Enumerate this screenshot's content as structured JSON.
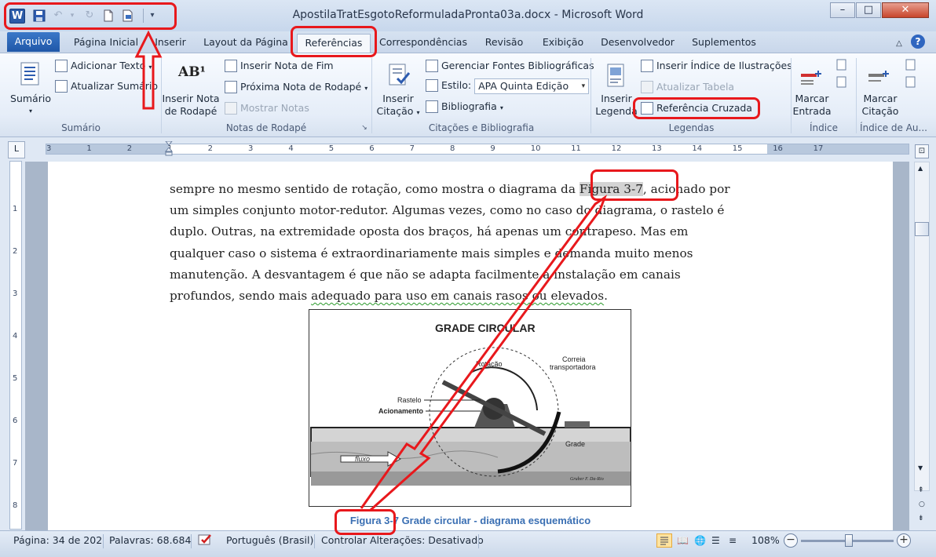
{
  "window": {
    "title": "ApostilaTratEsgotoReformuladaPronta03a.docx - Microsoft Word",
    "app_icon": "W",
    "minimize_label": "–",
    "maximize_label": "□",
    "close_label": "✕"
  },
  "tabs": {
    "file": "Arquivo",
    "items": [
      "Página Inicial",
      "Inserir",
      "Layout da Página",
      "Referências",
      "Correspondências",
      "Revisão",
      "Exibição",
      "Desenvolvedor",
      "Suplementos"
    ],
    "active": "Referências"
  },
  "ribbon": {
    "sumario": {
      "big_label": "Sumário",
      "add_text": "Adicionar Texto",
      "update": "Atualizar Sumário",
      "group": "Sumário"
    },
    "notas": {
      "insert_footnote": "Inserir Nota de Rodapé",
      "insert_footnote_line1": "Inserir Nota",
      "insert_footnote_line2": "de Rodapé",
      "footnote_icon": "AB¹",
      "insert_endnote": "Inserir Nota de Fim",
      "next_footnote": "Próxima Nota de Rodapé",
      "show_notes": "Mostrar Notas",
      "group": "Notas de Rodapé"
    },
    "citacoes": {
      "insert_citation_line1": "Inserir",
      "insert_citation_line2": "Citação",
      "manage_sources": "Gerenciar Fontes Bibliográficas",
      "style_label": "Estilo:",
      "style_value": "APA Quinta Edição",
      "bibliography": "Bibliografia",
      "group": "Citações e Bibliografia"
    },
    "legendas": {
      "insert_caption_line1": "Inserir",
      "insert_caption_line2": "Legenda",
      "insert_table_of_figures": "Inserir Índice de Ilustrações",
      "update_table": "Atualizar Tabela",
      "cross_reference": "Referência Cruzada",
      "group": "Legendas"
    },
    "indice": {
      "mark_entry_line1": "Marcar",
      "mark_entry_line2": "Entrada",
      "group": "Índice"
    },
    "indice_autoridades": {
      "mark_citation_line1": "Marcar",
      "mark_citation_line2": "Citação",
      "group": "Índice de Au..."
    }
  },
  "ruler": {
    "numbers": [
      "3",
      "1",
      "2",
      "1",
      "2",
      "3",
      "4",
      "5",
      "6",
      "7",
      "8",
      "9",
      "10",
      "11",
      "12",
      "13",
      "14",
      "15",
      "16",
      "17"
    ],
    "vertical_numbers": [
      "1",
      "2",
      "3",
      "4",
      "5",
      "6",
      "7",
      "8"
    ],
    "tab_selector": "L"
  },
  "document": {
    "paragraph_lines": [
      {
        "before": "sempre no mesmo sentido de rotação, como mostra o diagrama da ",
        "field": "Figura 3-7",
        "after": ", acionado por"
      },
      {
        "text": "um simples conjunto motor-redutor. Algumas vezes, como no caso do diagrama, o rastelo é"
      },
      {
        "text": "duplo. Outras, na extremidade oposta dos braços, há apenas um contrapeso. Mas em"
      },
      {
        "text": "qualquer caso o sistema é extraordinariamente  mais simples e demanda muito menos"
      },
      {
        "text": "manutenção. A desvantagem é que não se adapta facilmente a instalação em canais"
      },
      {
        "before": "profundos, sendo mais ",
        "squiggle": "adequado para uso em canais rasos ou elevados",
        "after": "."
      }
    ],
    "figure": {
      "title": "GRADE CIRCULAR",
      "labels": {
        "rotacao": "Rotação",
        "correia1": "Correia",
        "correia2": "transportadora",
        "rastelo": "Rastelo",
        "acionamento": "Acionamento",
        "grade": "Grade",
        "fluxo": "fluxo",
        "author": "Gruber F. Da-Rio"
      }
    },
    "caption": {
      "label": "Figura 3-7",
      "text": " Grade circular - diagrama esquemático"
    }
  },
  "status": {
    "page": "Página: 34 de 202",
    "words": "Palavras: 68.684",
    "language": "Português (Brasil)",
    "track_changes": "Controlar Alterações: Desativado",
    "zoom": "108%",
    "zoom_level_percent": 108,
    "zoom_minus": "−",
    "zoom_plus": "+"
  },
  "annotation_color": "#e8181c",
  "accent_color": "#2a5aa8",
  "caption_color": "#3a6fb3"
}
